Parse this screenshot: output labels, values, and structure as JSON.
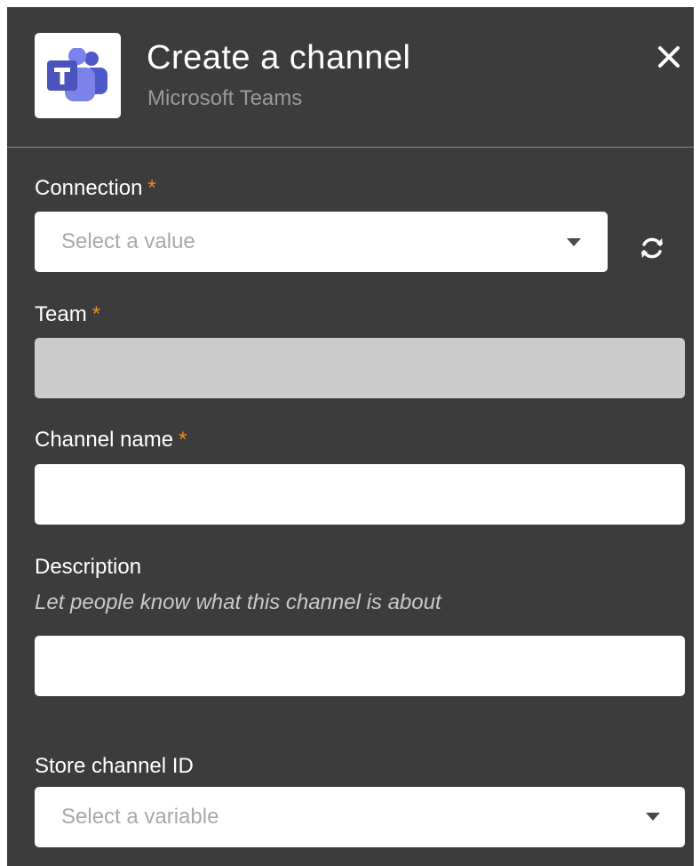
{
  "header": {
    "title": "Create a channel",
    "subtitle": "Microsoft Teams",
    "logo_icon": "microsoft-teams-icon",
    "close_icon": "close-icon",
    "close_glyph": "✕"
  },
  "colors": {
    "panel_bg": "#3c3c3c",
    "required_star": "#f0881a",
    "teams_purple": "#5059c9",
    "teams_purple_light": "#7b83eb"
  },
  "required_marker": "*",
  "fields": {
    "connection": {
      "label": "Connection",
      "required": true,
      "placeholder": "Select a value",
      "dropdown_icon": "chevron-down-icon",
      "refresh_icon": "refresh-icon"
    },
    "team": {
      "label": "Team",
      "required": true,
      "value": "",
      "disabled": true
    },
    "channel_name": {
      "label": "Channel name",
      "required": true,
      "value": ""
    },
    "description": {
      "label": "Description",
      "hint": "Let people know what this channel is about",
      "value": ""
    },
    "store_channel_id": {
      "label": "Store channel ID",
      "placeholder": "Select a variable",
      "dropdown_icon": "chevron-down-icon"
    }
  }
}
